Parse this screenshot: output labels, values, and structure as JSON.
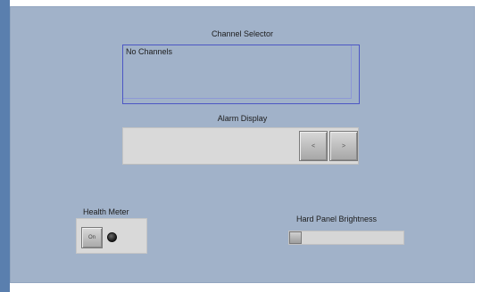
{
  "channel_selector": {
    "title": "Channel Selector",
    "items": [
      "No Channels"
    ]
  },
  "alarm_display": {
    "title": "Alarm Display",
    "prev_label": "<",
    "next_label": ">"
  },
  "health_meter": {
    "title": "Health Meter",
    "button_label": "On"
  },
  "hard_panel_brightness": {
    "title": "Hard Panel Brightness",
    "level": 0
  }
}
